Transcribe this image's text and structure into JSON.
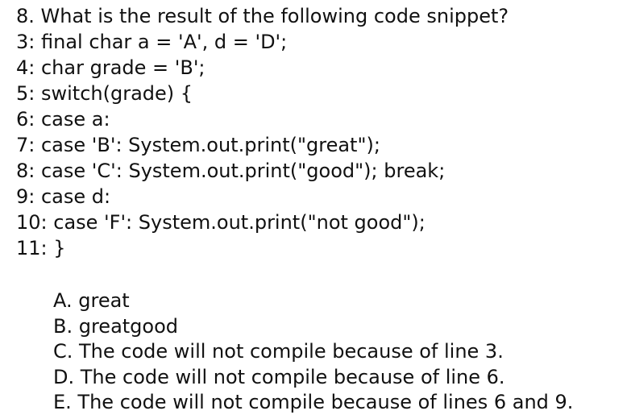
{
  "question": {
    "text": "8. What is the result of the following code snippet?"
  },
  "code_lines": [
    "3: final char a = 'A', d = 'D';",
    "4: char grade = 'B';",
    "5: switch(grade) {",
    "6: case a:",
    "7: case 'B': System.out.print(\"great\");",
    "8: case 'C': System.out.print(\"good\"); break;",
    "9: case d:",
    "10: case 'F': System.out.print(\"not good\");",
    "11: }"
  ],
  "options": [
    "A. great",
    "B. greatgood",
    "C. The code will not compile because of line 3.",
    "D. The code will not compile because of line 6.",
    "E. The code will not compile because of lines 6 and 9."
  ]
}
